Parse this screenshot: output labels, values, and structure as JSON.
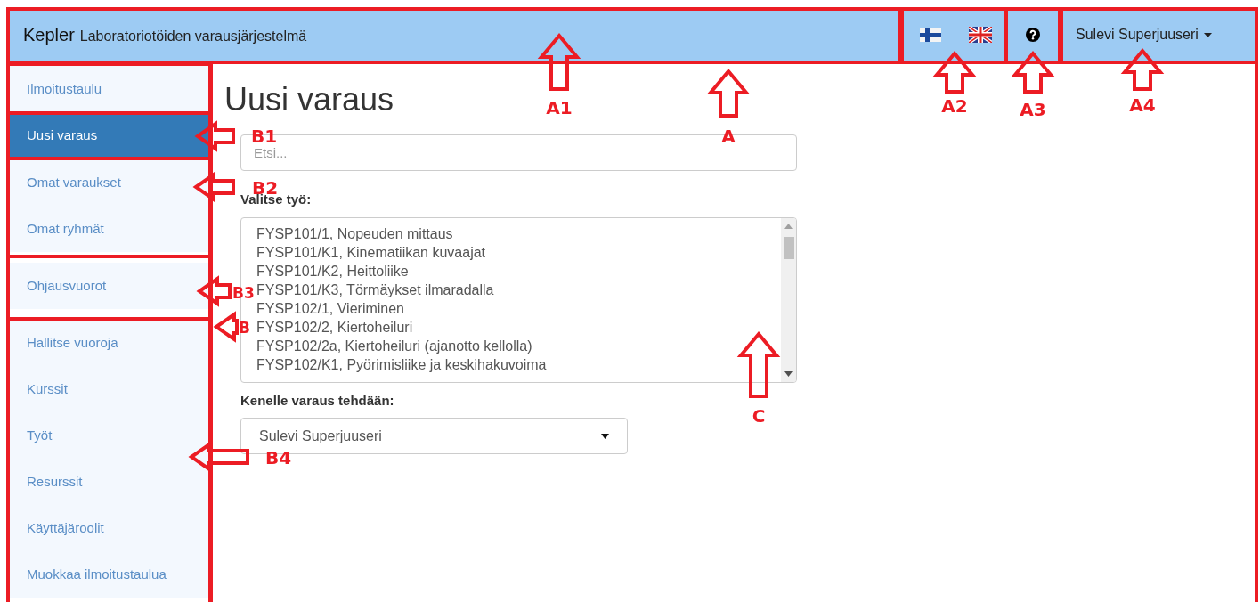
{
  "header": {
    "brand": "Kepler",
    "subtitle": "Laboratoriotöiden varausjärjestelmä",
    "user": "Sulevi Superjuuseri"
  },
  "sidebar": {
    "groups": [
      {
        "items": [
          {
            "label": "Ilmoitustaulu",
            "selected": false
          }
        ]
      },
      {
        "items": [
          {
            "label": "Uusi varaus",
            "selected": true
          }
        ]
      },
      {
        "items": [
          {
            "label": "Omat varaukset",
            "selected": false
          },
          {
            "label": "Omat ryhmät",
            "selected": false
          }
        ]
      },
      {
        "items": [
          {
            "label": "Ohjausvuorot",
            "selected": false
          }
        ]
      },
      {
        "items": [
          {
            "label": "Hallitse vuoroja",
            "selected": false
          },
          {
            "label": "Kurssit",
            "selected": false
          },
          {
            "label": "Työt",
            "selected": false
          },
          {
            "label": "Resurssit",
            "selected": false
          },
          {
            "label": "Käyttäjäroolit",
            "selected": false
          },
          {
            "label": "Muokkaa ilmoitustaulua",
            "selected": false
          }
        ]
      }
    ]
  },
  "main": {
    "title": "Uusi varaus",
    "search": {
      "placeholder": "Etsi..."
    },
    "work_label": "Valitse työ:",
    "works": [
      "FYSP101/1, Nopeuden mittaus",
      "FYSP101/K1, Kinematiikan kuvaajat",
      "FYSP101/K2, Heittoliike",
      "FYSP101/K3, Törmäykset ilmaradalla",
      "FYSP102/1, Vieriminen",
      "FYSP102/2, Kiertoheiluri",
      "FYSP102/2a, Kiertoheiluri (ajanotto kellolla)",
      "FYSP102/K1, Pyörimisliike ja keskihakuvoima"
    ],
    "for_label": "Kenelle varaus tehdään:",
    "for_value": "Sulevi Superjuuseri"
  },
  "annotations": [
    {
      "label": "A1",
      "kind": "up"
    },
    {
      "label": "A",
      "kind": "up"
    },
    {
      "label": "A2",
      "kind": "up"
    },
    {
      "label": "A3",
      "kind": "up"
    },
    {
      "label": "A4",
      "kind": "up"
    },
    {
      "label": "B1",
      "kind": "left"
    },
    {
      "label": "B2",
      "kind": "left"
    },
    {
      "label": "B3",
      "kind": "left"
    },
    {
      "label": "B",
      "kind": "left"
    },
    {
      "label": "B4",
      "kind": "left"
    },
    {
      "label": "C",
      "kind": "up"
    }
  ]
}
